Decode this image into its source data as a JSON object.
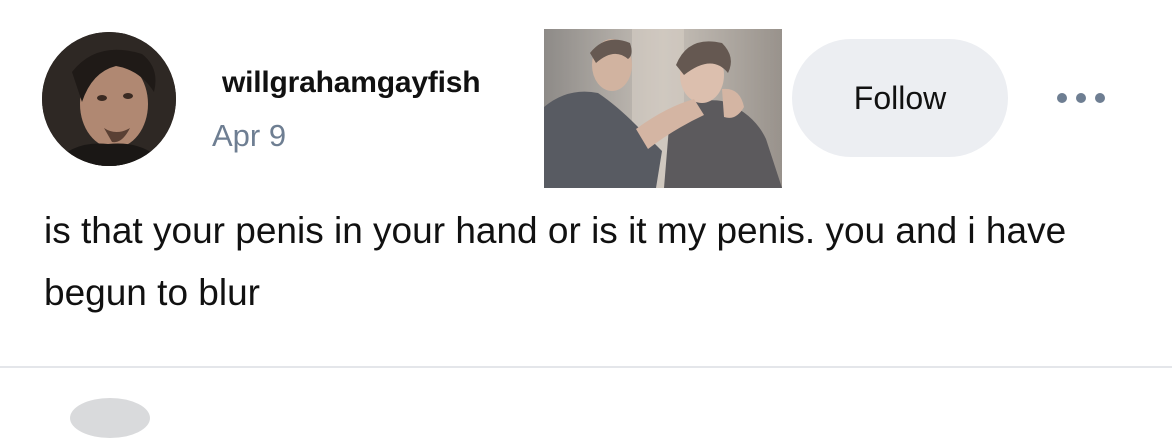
{
  "post": {
    "author": {
      "username": "willgrahamgayfish",
      "date": "Apr 9",
      "avatar_icon": "profile-photo"
    },
    "attached_image_icon": "photo-two-men-embracing",
    "follow_label": "Follow",
    "more_icon": "ellipsis-icon",
    "text": "is that your penis in your hand or is it my penis. you and i have begun to blur"
  },
  "colors": {
    "secondary_text": "#6e7e92",
    "follow_bg": "#eceef2",
    "divider": "#e4e6ea"
  }
}
